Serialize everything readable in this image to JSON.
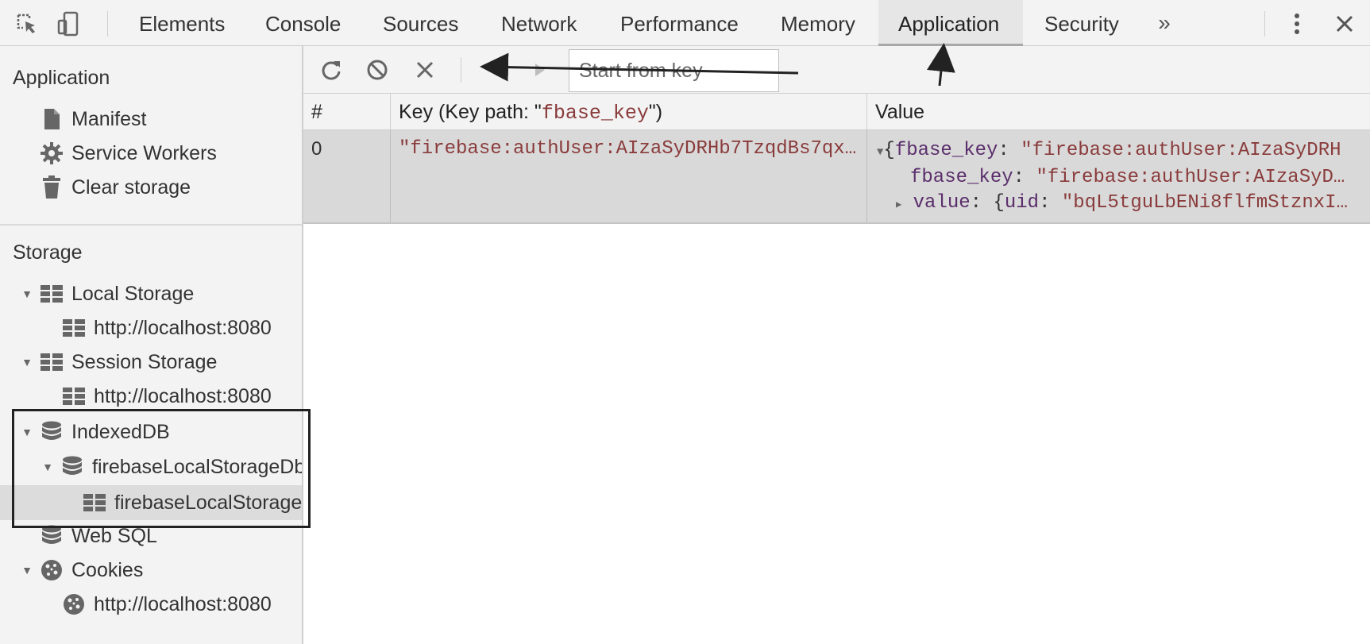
{
  "devtools": {
    "tabs": [
      {
        "label": "Elements",
        "active": false
      },
      {
        "label": "Console",
        "active": false
      },
      {
        "label": "Sources",
        "active": false
      },
      {
        "label": "Network",
        "active": false
      },
      {
        "label": "Performance",
        "active": false
      },
      {
        "label": "Memory",
        "active": false
      },
      {
        "label": "Application",
        "active": true
      },
      {
        "label": "Security",
        "active": false
      }
    ],
    "more_tabs": "»",
    "icons": {
      "inspect": "cursor-select-icon",
      "device": "device-toolbar-icon",
      "menu": "kebab-menu-icon",
      "close": "close-icon"
    }
  },
  "sidebar": {
    "application": {
      "title": "Application",
      "items": [
        {
          "label": "Manifest",
          "icon": "document-icon"
        },
        {
          "label": "Service Workers",
          "icon": "gear-icon"
        },
        {
          "label": "Clear storage",
          "icon": "trash-icon"
        }
      ]
    },
    "storage": {
      "title": "Storage",
      "items": [
        {
          "label": "Local Storage",
          "icon": "grid-storage-icon",
          "level": 0,
          "expanded": true
        },
        {
          "label": "http://localhost:8080",
          "icon": "grid-storage-icon",
          "level": 1
        },
        {
          "label": "Session Storage",
          "icon": "grid-storage-icon",
          "level": 0,
          "expanded": true
        },
        {
          "label": "http://localhost:8080",
          "icon": "grid-storage-icon",
          "level": 1
        },
        {
          "label": "IndexedDB",
          "icon": "database-icon",
          "level": 0,
          "expanded": true
        },
        {
          "label": "firebaseLocalStorageDb",
          "icon": "database-icon",
          "level": 1,
          "expanded": true
        },
        {
          "label": "firebaseLocalStorage",
          "icon": "grid-storage-icon",
          "level": 2,
          "selected": true
        },
        {
          "label": "Web SQL",
          "icon": "database-icon",
          "level": 0
        },
        {
          "label": "Cookies",
          "icon": "cookie-icon",
          "level": 0,
          "expanded": true
        },
        {
          "label": "http://localhost:8080",
          "icon": "cookie-icon",
          "level": 1
        }
      ]
    }
  },
  "toolbar": {
    "refresh_icon": "refresh-icon",
    "clear_icon": "block-icon",
    "delete_icon": "delete-x-icon",
    "prev_icon": "prev-page-icon",
    "next_icon": "next-page-icon",
    "key_input_placeholder": "Start from key"
  },
  "table": {
    "headers": {
      "index": "#",
      "key_prefix": "Key (Key path: \"",
      "key_path": "fbase_key",
      "key_suffix": "\")",
      "value": "Value"
    },
    "rows": [
      {
        "index": "0",
        "key": "\"firebase:authUser:AIzaSyDRHb7TzqdBs7qx…",
        "value_line1_prop": "fbase_key",
        "value_line1_str": "\"firebase:authUser:AIzaSyDRH",
        "value_line2_prop": "fbase_key",
        "value_line2_str": "\"firebase:authUser:AIzaSyD…",
        "value_line3_prop": "value",
        "value_line3_key": "uid",
        "value_line3_str": "\"bqL5tguLbENi8flfmStznxI…"
      }
    ]
  },
  "colors": {
    "panel_bg": "#f3f3f3",
    "selected_row": "#d9d9d9",
    "string_color": "#8a3b3b",
    "annotation": "#222222"
  }
}
